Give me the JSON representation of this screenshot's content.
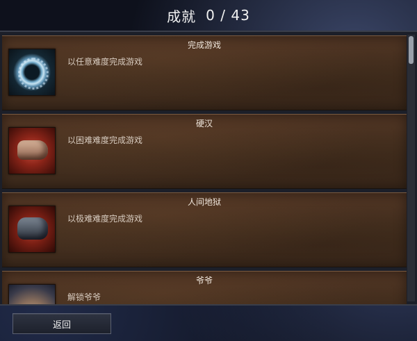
{
  "header": {
    "title": "成就",
    "progress": "0 / 43"
  },
  "achievements": [
    {
      "title": "完成游戏",
      "description": "以任意难度完成游戏",
      "icon": "blue-ring-icon"
    },
    {
      "title": "硬汉",
      "description": "以困难难度完成游戏",
      "icon": "fist-icon"
    },
    {
      "title": "人间地狱",
      "description": "以极难难度完成游戏",
      "icon": "gauntlet-fist-icon"
    },
    {
      "title": "爷爷",
      "description": "解锁爷爷",
      "icon": "grandpa-portrait-icon"
    }
  ],
  "footer": {
    "back_label": "返回"
  }
}
